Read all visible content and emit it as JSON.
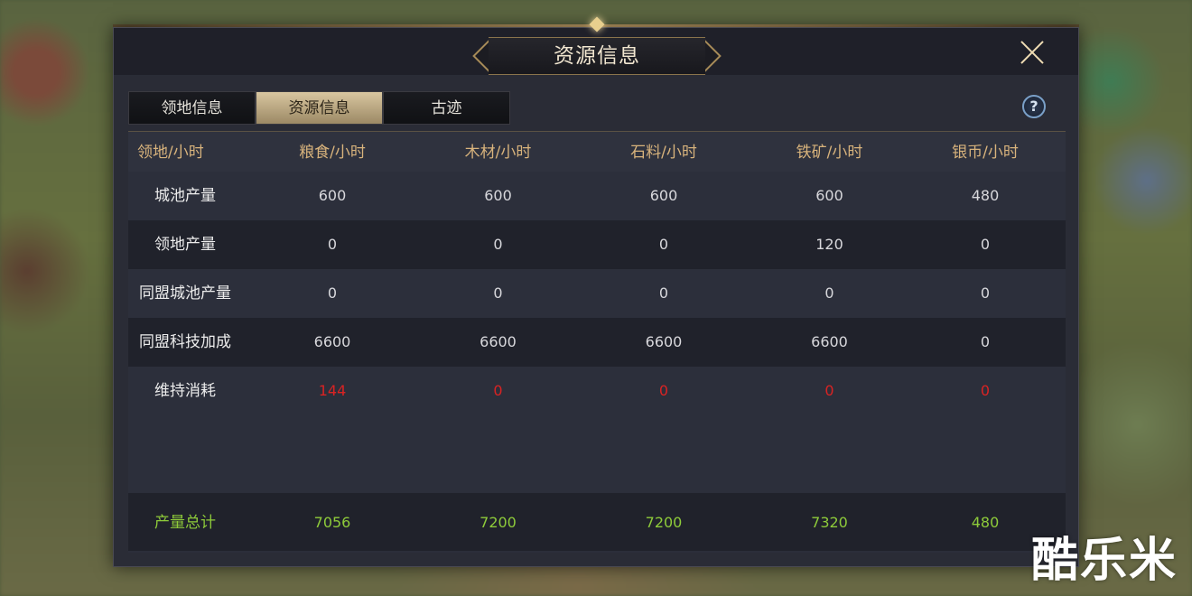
{
  "window": {
    "title": "资源信息"
  },
  "tabs": [
    {
      "label": "领地信息",
      "active": false
    },
    {
      "label": "资源信息",
      "active": true
    },
    {
      "label": "古迹",
      "active": false
    }
  ],
  "help": {
    "label": "?"
  },
  "table": {
    "headers": [
      "领地/小时",
      "粮食/小时",
      "木材/小时",
      "石料/小时",
      "铁矿/小时",
      "银币/小时"
    ],
    "rows": [
      {
        "label": "城池产量",
        "values": [
          "600",
          "600",
          "600",
          "600",
          "480"
        ]
      },
      {
        "label": "领地产量",
        "values": [
          "0",
          "0",
          "0",
          "120",
          "0"
        ]
      },
      {
        "label": "同盟城池产量",
        "values": [
          "0",
          "0",
          "0",
          "0",
          "0"
        ]
      },
      {
        "label": "同盟科技加成",
        "values": [
          "6600",
          "6600",
          "6600",
          "6600",
          "0"
        ]
      },
      {
        "label": "维持消耗",
        "values": [
          "144",
          "0",
          "0",
          "0",
          "0"
        ]
      }
    ],
    "total": {
      "label": "产量总计",
      "values": [
        "7056",
        "7200",
        "7200",
        "7320",
        "480"
      ]
    }
  },
  "colors": {
    "header_text": "#d8b37c",
    "upkeep_text": "#d92323",
    "total_text": "#8ecb3a",
    "accent_gold": "#c9a56a"
  },
  "watermark": "酷乐米"
}
